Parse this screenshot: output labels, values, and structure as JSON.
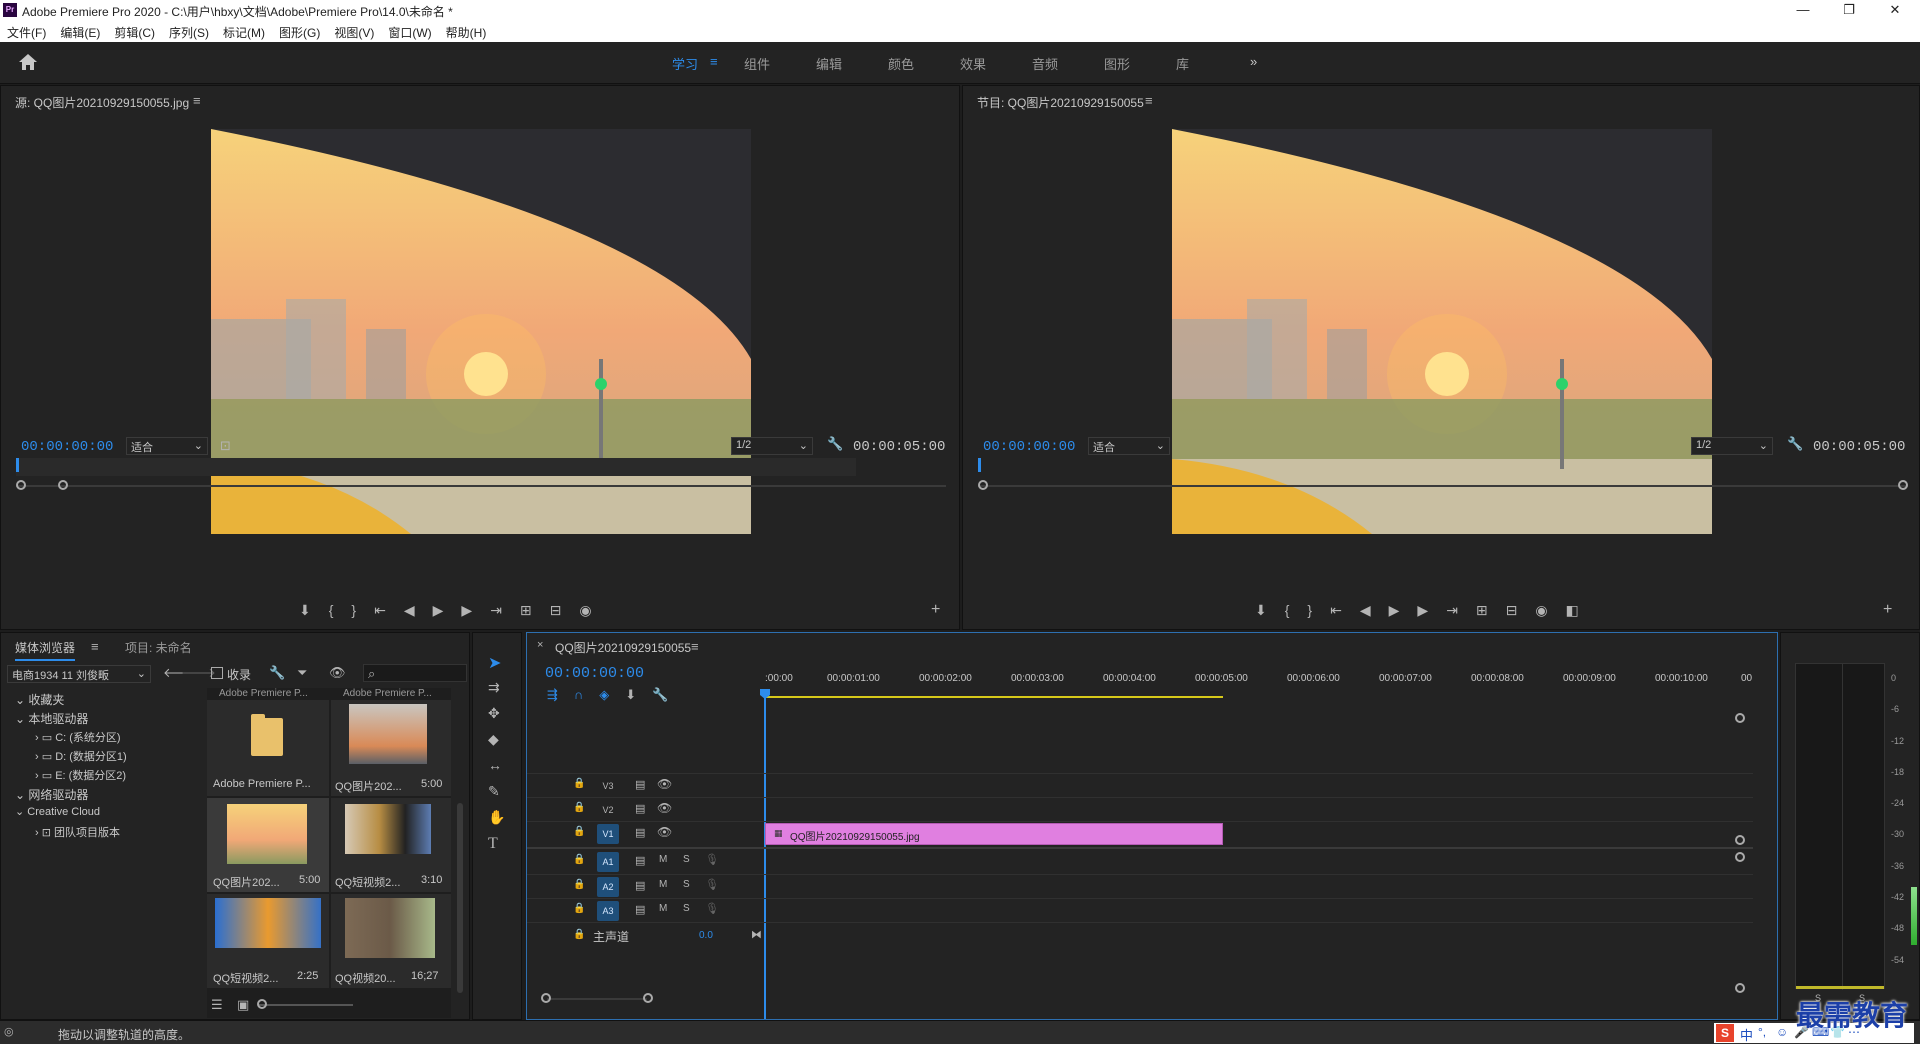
{
  "app": {
    "title": "Adobe Premiere Pro 2020 - C:\\用户\\hbxy\\文档\\Adobe\\Premiere Pro\\14.0\\未命名 *",
    "logo": "Pr"
  },
  "window_controls": {
    "minimize": "—",
    "maximize": "❐",
    "close": "✕"
  },
  "menu": [
    "文件(F)",
    "编辑(E)",
    "剪辑(C)",
    "序列(S)",
    "标记(M)",
    "图形(G)",
    "视图(V)",
    "窗口(W)",
    "帮助(H)"
  ],
  "workspaces": {
    "items": [
      "学习",
      "组件",
      "编辑",
      "颜色",
      "效果",
      "音频",
      "图形",
      "库"
    ],
    "active": "学习",
    "overflow": "»"
  },
  "source_monitor": {
    "title": "源: QQ图片20210929150055.jpg",
    "timecode_in": "00:00:00:00",
    "fit": "适合",
    "resolution": "1/2",
    "timecode_out": "00:00:05:00"
  },
  "program_monitor": {
    "title": "节目: QQ图片20210929150055",
    "timecode_in": "00:00:00:00",
    "fit": "适合",
    "resolution": "1/2",
    "timecode_out": "00:00:05:00"
  },
  "media_browser": {
    "tab_active": "媒体浏览器",
    "tab_other": "项目: 未命名",
    "location": "电商1934 11 刘俊畈",
    "ingest_label": "收录",
    "tree": [
      {
        "label": "收藏夹",
        "level": 0
      },
      {
        "label": "本地驱动器",
        "level": 0
      },
      {
        "label": "C: (系统分区)",
        "level": 1
      },
      {
        "label": "D: (数据分区1)",
        "level": 1
      },
      {
        "label": "E: (数据分区2)",
        "level": 1
      },
      {
        "label": "网络驱动器",
        "level": 0
      },
      {
        "label": "Creative Cloud",
        "level": 0
      },
      {
        "label": "团队项目版本",
        "level": 1
      }
    ],
    "top_labels": [
      "Adobe Premiere P...",
      "Adobe Premiere P..."
    ],
    "thumbnails": [
      {
        "name": "Adobe Premiere P...",
        "duration": ""
      },
      {
        "name": "QQ图片202...",
        "duration": "5:00"
      },
      {
        "name": "QQ图片202...",
        "duration": "5:00"
      },
      {
        "name": "QQ短视频2...",
        "duration": "3:10"
      },
      {
        "name": "QQ短视频2...",
        "duration": "2:25"
      },
      {
        "name": "QQ视频20...",
        "duration": "16;27"
      }
    ]
  },
  "timeline": {
    "sequence_name": "QQ图片20210929150055",
    "timecode": "00:00:00:00",
    "ruler": [
      ":00:00",
      "00:00:01:00",
      "00:00:02:00",
      "00:00:03:00",
      "00:00:04:00",
      "00:00:05:00",
      "00:00:06:00",
      "00:00:07:00",
      "00:00:08:00",
      "00:00:09:00",
      "00:00:10:00",
      "00"
    ],
    "video_tracks": [
      "V3",
      "V2",
      "V1"
    ],
    "audio_tracks": [
      "A1",
      "A2",
      "A3"
    ],
    "mute_label": "M",
    "solo_label": "S",
    "master_label": "主声道",
    "master_value": "0.0",
    "clip_name": "QQ图片20210929150055.jpg",
    "clip_color": "#e07fe0"
  },
  "audio_meter": {
    "scale": [
      "0",
      "-6",
      "-12",
      "-18",
      "-24",
      "-30",
      "-36",
      "-42",
      "-48",
      "-54"
    ],
    "bottom": [
      "S",
      "S"
    ]
  },
  "status_bar": {
    "hint": "拖动以调整轨道的高度。"
  },
  "watermark": "最需教育",
  "ime": [
    "中",
    "°,",
    "☺",
    "🎤",
    "⌨",
    "👕",
    "⋯"
  ],
  "colors": {
    "accent": "#2d8ceb",
    "panel": "#232323",
    "background": "#1d1d1d"
  }
}
